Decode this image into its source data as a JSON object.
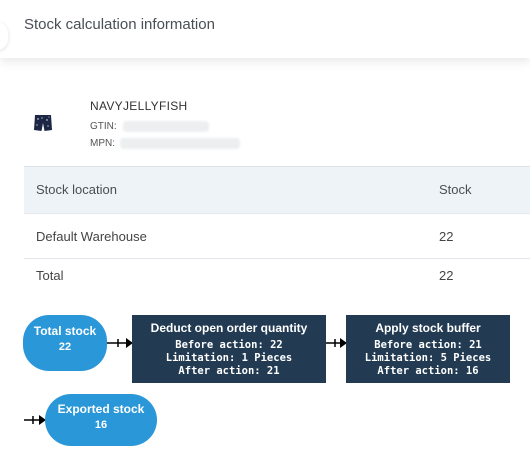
{
  "header": {
    "title": "Stock calculation information"
  },
  "product": {
    "name": "NAVYJELLYFISH",
    "gtin_label": "GTIN:",
    "mpn_label": "MPN:",
    "thumb_icon": "shorts-icon"
  },
  "table": {
    "columns": [
      "Stock location",
      "Stock"
    ],
    "rows": [
      {
        "location": "Default Warehouse",
        "stock": "22"
      }
    ],
    "total": {
      "label": "Total",
      "stock": "22"
    }
  },
  "flow": {
    "total_stock": {
      "title": "Total stock",
      "value": "22"
    },
    "deduct": {
      "title": "Deduct open order quantity",
      "lines": [
        "Before action: 22",
        "Limitation: 1 Pieces",
        "After action: 21"
      ]
    },
    "buffer": {
      "title": "Apply stock buffer",
      "lines": [
        "Before action: 21",
        "Limitation: 5 Pieces",
        "After action: 16"
      ]
    },
    "exported_stock": {
      "title": "Exported stock",
      "value": "16"
    }
  },
  "colors": {
    "oval": "#2997d8",
    "box": "#223a52",
    "table_header": "#eef3f7"
  }
}
